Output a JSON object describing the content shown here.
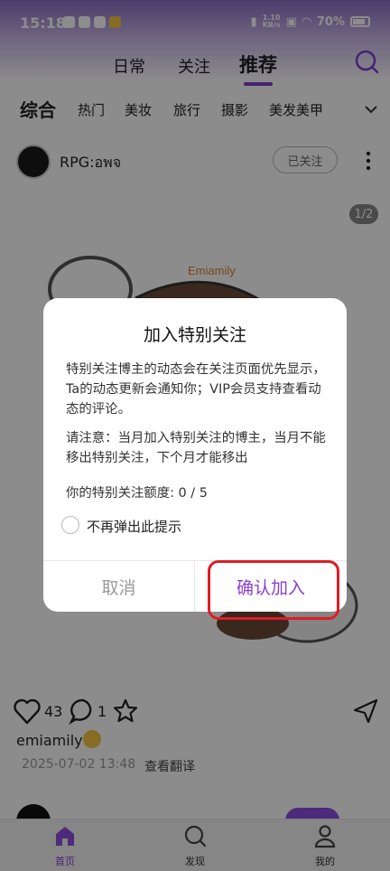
{
  "status_bar": {
    "time": "15:18",
    "net_rate_top": "1.10",
    "net_rate_bottom": "KB/s",
    "battery": "70%"
  },
  "top_tabs": [
    "日常",
    "关注",
    "推荐"
  ],
  "active_top_tab": "推荐",
  "categories": [
    "综合",
    "热门",
    "美妆",
    "旅行",
    "摄影",
    "美发美甲"
  ],
  "post": {
    "author": "RPG:อพจ",
    "follow_label": "已关注",
    "page_indicator": "1/2",
    "like_count": "43",
    "comment_count": "1",
    "caption": "emiamily",
    "date": "2025-07-02 13:48",
    "translate_label": "查看翻译",
    "illustration_text": "Emiamily"
  },
  "dialog": {
    "title": "加入特别关注",
    "para1": "特别关注博主的动态会在关注页面优先显示，Ta的动态更新会通知你；VIP会员支持查看动态的评论。",
    "para2": "请注意：当月加入特别关注的博主，当月不能移出特别关注，下个月才能移出",
    "quota": "你的特别关注额度: 0 / 5",
    "checkbox_label": "不再弹出此提示",
    "cancel": "取消",
    "confirm": "确认加入"
  },
  "bottom_nav": [
    "首页",
    "发现",
    "我的"
  ],
  "colors": {
    "accent": "#7f3fcf",
    "highlight": "#e01b24"
  }
}
